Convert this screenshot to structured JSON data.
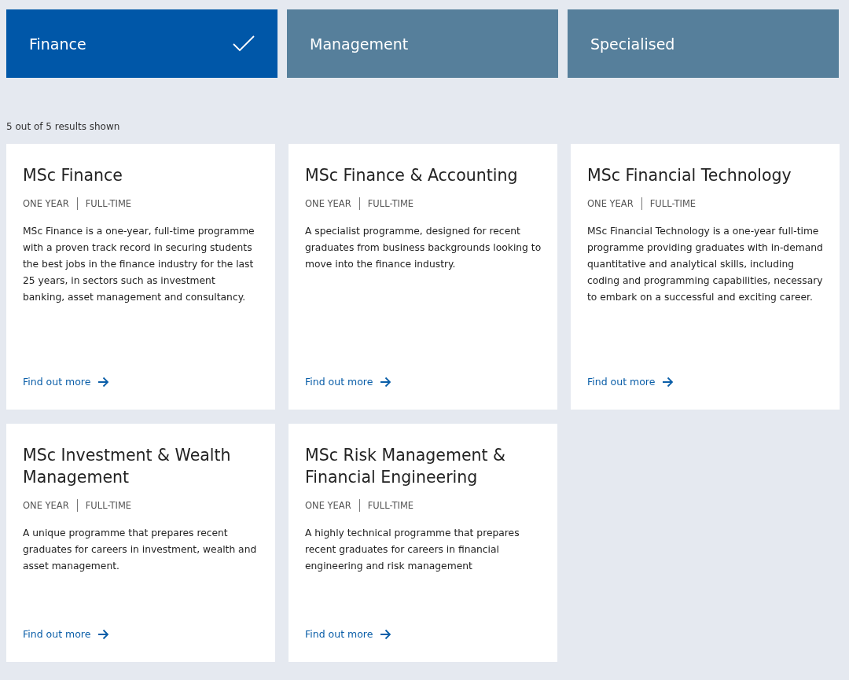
{
  "tabs": [
    {
      "label": "Finance",
      "selected": true
    },
    {
      "label": "Management",
      "selected": false
    },
    {
      "label": "Specialised",
      "selected": false
    }
  ],
  "results_count": "5 out of 5 results shown",
  "programmes": [
    {
      "title": "MSc Finance",
      "meta": [
        "ONE YEAR",
        "FULL-TIME"
      ],
      "description": "MSc Finance is a one-year, full-time programme with a proven track record in securing students the best jobs in the finance industry for the last 25 years, in sectors such as investment banking, asset management and consultancy.",
      "link": "Find out more"
    },
    {
      "title": "MSc Finance & Accounting",
      "meta": [
        "ONE YEAR",
        "FULL-TIME"
      ],
      "description": "A specialist programme, designed for recent graduates from business backgrounds looking to move into the finance industry.",
      "link": "Find out more"
    },
    {
      "title": "MSc Financial Technology",
      "meta": [
        "ONE YEAR",
        "FULL-TIME"
      ],
      "description": "MSc Financial Technology is a one-year full-time programme providing graduates with in-demand quantitative and analytical skills, including coding and programming capabilities, necessary to embark on a successful and exciting career.",
      "link": "Find out more"
    },
    {
      "title": "MSc Investment & Wealth Management",
      "meta": [
        "ONE YEAR",
        "FULL-TIME"
      ],
      "description": "A unique programme that prepares recent graduates for careers in investment, wealth and asset management.",
      "link": "Find out more"
    },
    {
      "title": "MSc Risk Management & Financial Engineering",
      "meta": [
        "ONE YEAR",
        "FULL-TIME"
      ],
      "description": "A highly technical programme that prepares recent graduates for careers in financial engineering and risk management",
      "link": "Find out more"
    }
  ]
}
